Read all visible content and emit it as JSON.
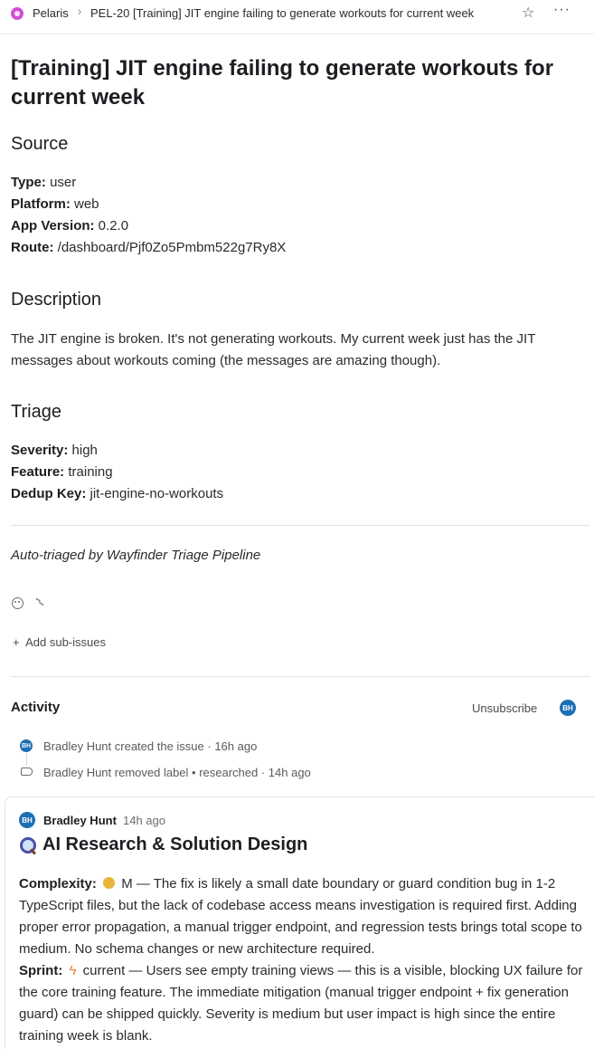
{
  "breadcrumb": {
    "team": "Pelaris",
    "issue": "PEL-20  [Training] JIT engine failing to generate workouts for current week"
  },
  "issue": {
    "title": "[Training] JIT engine failing to generate workouts for current week",
    "source": {
      "heading": "Source",
      "type_label": "Type:",
      "type_value": " user",
      "platform_label": "Platform:",
      "platform_value": " web",
      "version_label": "App Version:",
      "version_value": " 0.2.0",
      "route_label": "Route:",
      "route_value": " /dashboard/Pjf0Zo5Pmbm522g7Ry8X"
    },
    "description": {
      "heading": "Description",
      "text": "The JIT engine is broken. It's not generating workouts. My current week just has the JIT messages about workouts coming (the messages are amazing though)."
    },
    "triage": {
      "heading": "Triage",
      "severity_label": "Severity:",
      "severity_value": " high",
      "feature_label": "Feature:",
      "feature_value": " training",
      "dedup_label": "Dedup Key:",
      "dedup_value": " jit-engine-no-workouts"
    },
    "footer_note": "Auto-triaged by Wayfinder Triage Pipeline",
    "add_sub_issues": "Add sub-issues"
  },
  "activity": {
    "title": "Activity",
    "unsubscribe": "Unsubscribe",
    "avatar_initials": "BH",
    "events": [
      "Bradley Hunt created the issue · 16h ago",
      "Bradley Hunt removed label • researched · 14h ago"
    ]
  },
  "comment": {
    "author": "Bradley Hunt",
    "time": "14h ago",
    "heading": "AI Research & Solution Design",
    "complexity_label": "Complexity:",
    "complexity_text": "M — The fix is likely a small date boundary or guard condition bug in 1-2 TypeScript files, but the lack of codebase access means investigation is required first. Adding proper error propagation, a manual trigger endpoint, and regression tests brings total scope to medium. No schema changes or new architecture required.",
    "sprint_label": "Sprint:",
    "sprint_text": "current — Users see empty training views — this is a visible, blocking UX failure for the core training feature. The immediate mitigation (manual trigger endpoint + fix generation guard) can be shipped quickly. Severity is medium but user impact is high since the entire training week is blank."
  },
  "icons": {
    "team": "team-icon",
    "star": "star-icon",
    "more": "more-icon",
    "emoji": "emoji-icon",
    "attach": "paperclip-icon",
    "label": "label-icon",
    "magnifier": "magnifying-glass-icon",
    "moon": "moon-icon",
    "bolt": "lightning-icon"
  }
}
